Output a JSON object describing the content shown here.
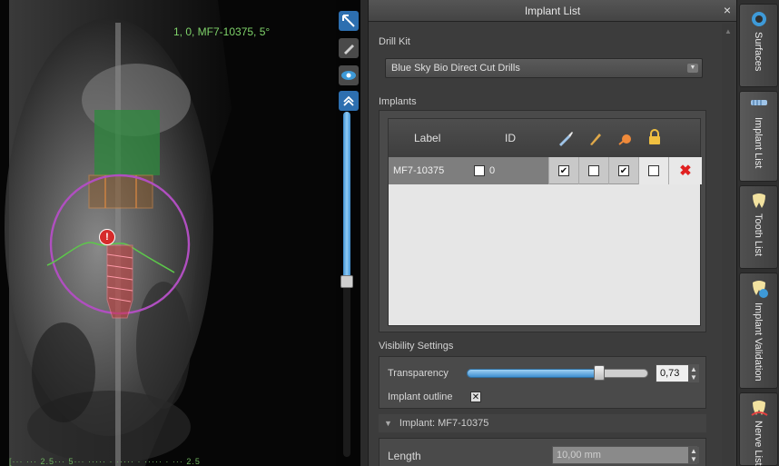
{
  "viewer": {
    "overlay_label": "1, 0, MF7-10375, 5°",
    "implant_marker": "!",
    "tools": [
      "reset-view-icon",
      "pencil-icon",
      "eye-icon",
      "chevron-up-icon"
    ],
    "ruler_text": "[···  ··· 2.5···  5···  ·····  ·  ·····  ·  ·····  ·  ··· 2.5"
  },
  "panel": {
    "title": "Implant List",
    "close": "×",
    "drill_kit": {
      "label": "Drill Kit",
      "selected": "Blue Sky Bio Direct Cut Drills"
    },
    "implants": {
      "label": "Implants",
      "columns": [
        "Label",
        "ID"
      ],
      "column_icons": [
        "drill-icon",
        "pencil-icon",
        "marker-icon",
        "lock-icon"
      ],
      "rows": [
        {
          "label": "MF7-10375",
          "id": "0",
          "id_checked": false,
          "col_drill": true,
          "col_pencil": false,
          "col_marker": true,
          "col_lock": false,
          "delete": "✖"
        }
      ]
    },
    "visibility": {
      "label": "Visibility Settings",
      "transparency_label": "Transparency",
      "transparency_value": "0,73",
      "transparency_level": 0.73,
      "outline_label": "Implant outline",
      "outline_checked": true
    },
    "implant_section": {
      "header": "Implant: MF7-10375",
      "length_label": "Length",
      "length_value": "10,00 mm"
    }
  },
  "tabs": [
    {
      "label": "Surfaces",
      "icon": "surfaces-icon"
    },
    {
      "label": "Implant List",
      "icon": "implant-icon"
    },
    {
      "label": "Tooth List",
      "icon": "tooth-icon"
    },
    {
      "label": "Implant Validation",
      "icon": "validation-icon"
    },
    {
      "label": "Nerve List",
      "icon": "nerve-icon"
    }
  ],
  "colors": {
    "accent_blue": "#3d8fd1",
    "implant_green": "#2e8a3e",
    "circle_magenta": "#b04fc0",
    "delete_red": "#e02020"
  }
}
